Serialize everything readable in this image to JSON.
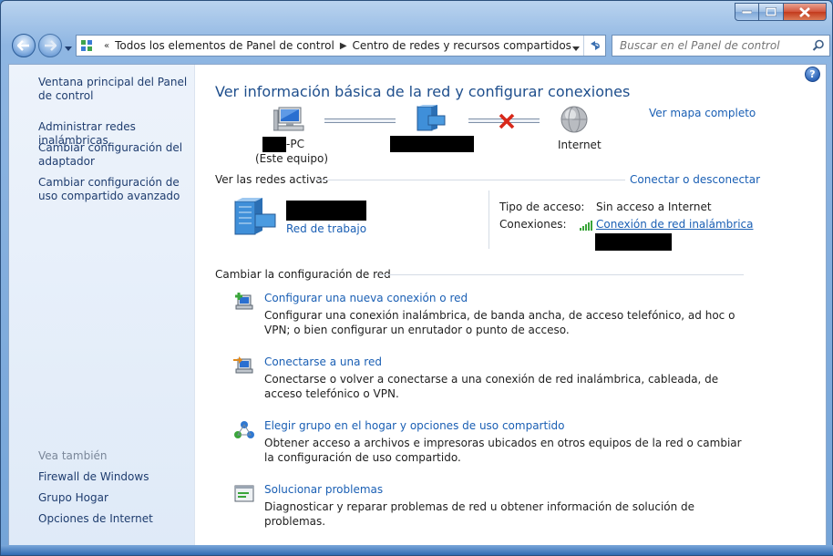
{
  "window": {
    "caption": {
      "minimize": "minimize",
      "maximize": "maximize",
      "close": "close"
    }
  },
  "address_bar": {
    "crumbs": [
      "Todos los elementos de Panel de control",
      "Centro de redes y recursos compartidos"
    ]
  },
  "search": {
    "placeholder": "Buscar en el Panel de control"
  },
  "sidebar": {
    "items": [
      {
        "label": "Ventana principal del Panel de control"
      },
      {
        "label": "Administrar redes inalámbricas"
      },
      {
        "label": "Cambiar configuración del adaptador"
      },
      {
        "label": "Cambiar configuración de uso compartido avanzado"
      }
    ],
    "see_also_title": "Vea también",
    "see_also": [
      {
        "label": "Firewall de Windows"
      },
      {
        "label": "Grupo Hogar"
      },
      {
        "label": "Opciones de Internet"
      }
    ]
  },
  "main": {
    "title": "Ver información básica de la red y configurar conexiones",
    "full_map_link": "Ver mapa completo",
    "diagram": {
      "pc_suffix": "-PC",
      "pc_sub": "(Este equipo)",
      "internet_label": "Internet"
    },
    "active_networks": {
      "title": "Ver las redes activas",
      "connect_link": "Conectar o desconectar",
      "network_type_link": "Red de trabajo",
      "access_type_label": "Tipo de acceso:",
      "access_type_value": "Sin acceso a Internet",
      "connections_label": "Conexiones:",
      "connections_value": "Conexión de red inalámbrica"
    },
    "change_settings": {
      "title": "Cambiar la configuración de red",
      "tasks": [
        {
          "link": "Configurar una nueva conexión o red",
          "desc": "Configurar una conexión inalámbrica, de banda ancha, de acceso telefónico, ad hoc o VPN; o bien configurar un enrutador o punto de acceso."
        },
        {
          "link": "Conectarse a una red",
          "desc": "Conectarse o volver a conectarse a una conexión de red inalámbrica, cableada, de acceso telefónico o VPN."
        },
        {
          "link": "Elegir grupo en el hogar y opciones de uso compartido",
          "desc": "Obtener acceso a archivos e impresoras ubicados en otros equipos de la red o cambiar la configuración de uso compartido."
        },
        {
          "link": "Solucionar problemas",
          "desc": "Diagnosticar y reparar problemas de red u obtener información de solución de problemas."
        }
      ]
    }
  },
  "colors": {
    "link": "#1a5fb4",
    "title": "#1e4e8c",
    "sidebar_link": "#1e3c6e"
  }
}
